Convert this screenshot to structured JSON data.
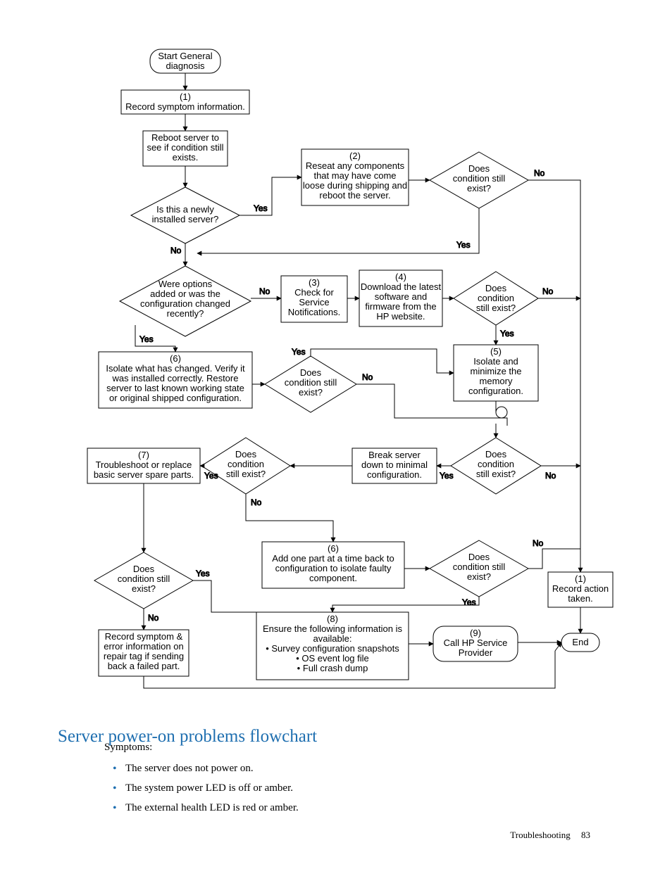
{
  "flow": {
    "start": [
      "Start General",
      "diagnosis"
    ],
    "b1": [
      "(1)",
      "Record symptom information."
    ],
    "reboot": [
      "Reboot server to",
      "see if condition still",
      "exists."
    ],
    "d_new": [
      "Is this a newly",
      "installed server?"
    ],
    "b2": [
      "(2)",
      "Reseat any components",
      "that may have come",
      "loose during shipping and",
      "reboot the server."
    ],
    "d_cond1": [
      "Does",
      "condition still",
      "exist?"
    ],
    "d_opts": [
      "Were options",
      "added or was the",
      "configuration changed",
      "recently?"
    ],
    "b3": [
      "(3)",
      "Check for",
      "Service",
      "Notifications."
    ],
    "b4": [
      "(4)",
      "Download the latest",
      "software and",
      "firmware from the",
      "HP website."
    ],
    "d_cond2": [
      "Does",
      "condition",
      "still exist?"
    ],
    "b5": [
      "(5)",
      "Isolate and",
      "minimize the",
      "memory",
      "configuration."
    ],
    "b6": [
      "(6)",
      "Isolate what has changed. Verify it",
      "was installed correctly.  Restore",
      "server to last known working state",
      "or original shipped configuration."
    ],
    "d_cond3": [
      "Does",
      "condition still",
      "exist?"
    ],
    "b7": [
      "(7)",
      "Troubleshoot or replace",
      "basic server spare parts."
    ],
    "d_cond4": [
      "Does",
      "condition",
      "still exist?"
    ],
    "break": [
      "Break server",
      "down to minimal",
      "configuration."
    ],
    "d_cond5": [
      "Does",
      "condition",
      "still exist?"
    ],
    "d_cond6": [
      "Does",
      "condition still",
      "exist?"
    ],
    "b6b": [
      "(6)",
      "Add one part at a time back to",
      "configuration to isolate faulty",
      "component."
    ],
    "d_cond7": [
      "Does",
      "condition still",
      "exist?"
    ],
    "b1b": [
      "(1)",
      "Record action",
      "taken."
    ],
    "record": [
      "Record symptom &",
      "error information on",
      "repair tag if sending",
      "back a failed part."
    ],
    "b8": [
      "(8)",
      "Ensure the following information is",
      "available:",
      "• Survey configuration snapshots",
      "• OS event log file",
      "• Full crash dump"
    ],
    "b9": [
      "(9)",
      "Call HP Service",
      "Provider"
    ],
    "end": [
      "End"
    ]
  },
  "labels": {
    "yes": "Yes",
    "no": "No"
  },
  "heading": "Server power-on problems flowchart",
  "symptoms": {
    "intro": "Symptoms:",
    "items": [
      "The server does not power on.",
      "The system power LED is off or amber.",
      "The external health LED is red or amber."
    ]
  },
  "footer": {
    "section": "Troubleshooting",
    "page": "83"
  }
}
